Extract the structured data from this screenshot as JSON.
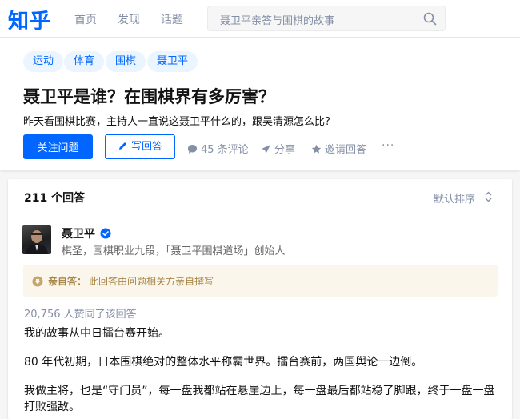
{
  "header": {
    "logo": "知乎",
    "nav": [
      "首页",
      "发现",
      "话题"
    ],
    "search_placeholder": "聂卫平亲答与围棋的故事"
  },
  "question": {
    "topics": [
      "运动",
      "体育",
      "围棋",
      "聂卫平"
    ],
    "title": "聂卫平是谁？在围棋界有多厉害？",
    "detail": "昨天看围棋比赛，主持人一直说这聂卫平什么的，跟吴清源怎么比?",
    "follow_label": "关注问题",
    "write_answer_label": "写回答",
    "comments_label": "45 条评论",
    "share_label": "分享",
    "invite_label": "邀请回答",
    "more_label": "···"
  },
  "answers": {
    "count_label": "211 个回答",
    "sort_label": "默认排序",
    "author": {
      "name": "聂卫平",
      "bio": "棋圣，围棋职业九段，「聂卫平围棋道场」创始人"
    },
    "notice": {
      "strong": "亲自答：",
      "text": "此回答由问题相关方亲自撰写"
    },
    "votes_label": "20,756 人赞同了该回答",
    "paragraphs": [
      "我的故事从中日擂台赛开始。",
      "80 年代初期，日本围棋绝对的整体水平称霸世界。擂台赛前，两国舆论一边倒。",
      "我做主将，也是“守门员”，每一盘我都站在悬崖边上，每一盘最后都站稳了脚跟，终于一盘一盘",
      "打败强敌。"
    ]
  },
  "colors": {
    "brand": "#0066ff",
    "tag_bg": "#ebf5ff",
    "muted": "#8590a6",
    "notice_bg": "#fbf6ec",
    "notice_text": "#a88548"
  },
  "icons": [
    "search-icon",
    "pen-icon",
    "comment-icon",
    "share-icon",
    "star-icon",
    "sort-icon",
    "verified-icon",
    "notice-icon"
  ]
}
